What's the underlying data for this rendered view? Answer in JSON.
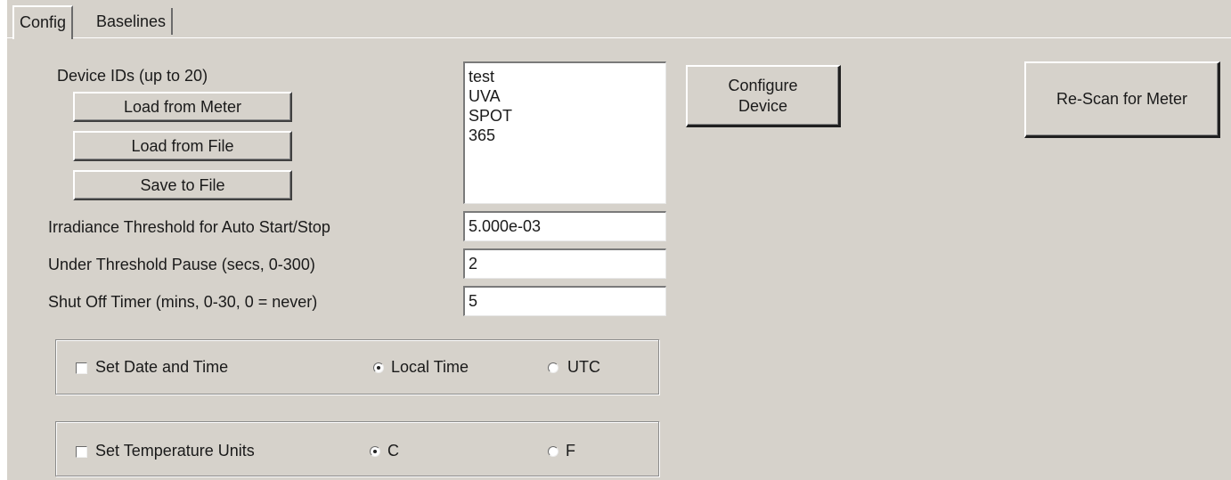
{
  "tabs": [
    {
      "label": "Config",
      "active": true
    },
    {
      "label": "Baselines",
      "active": false
    }
  ],
  "device_ids": {
    "label": "Device IDs (up to 20)",
    "items": [
      "test",
      "UVA",
      "SPOT",
      "365"
    ]
  },
  "buttons": {
    "load_from_meter": "Load from Meter",
    "load_from_file": "Load from File",
    "save_to_file": "Save to File",
    "configure_device_line1": "Configure",
    "configure_device_line2": "Device",
    "rescan": "Re-Scan for Meter"
  },
  "settings": {
    "irradiance": {
      "label": "Irradiance Threshold for Auto Start/Stop",
      "value": "5.000e-03"
    },
    "pause": {
      "label": "Under Threshold Pause (secs, 0-300)",
      "value": "2"
    },
    "shutoff": {
      "label": "Shut Off Timer (mins, 0-30, 0 = never)",
      "value": "5"
    }
  },
  "date_time": {
    "checkbox_label": "Set Date and Time",
    "checked": false,
    "options": [
      "Local Time",
      "UTC"
    ],
    "selected": "Local Time"
  },
  "temperature": {
    "checkbox_label": "Set Temperature Units",
    "checked": false,
    "options": [
      "C",
      "F"
    ],
    "selected": "C"
  }
}
